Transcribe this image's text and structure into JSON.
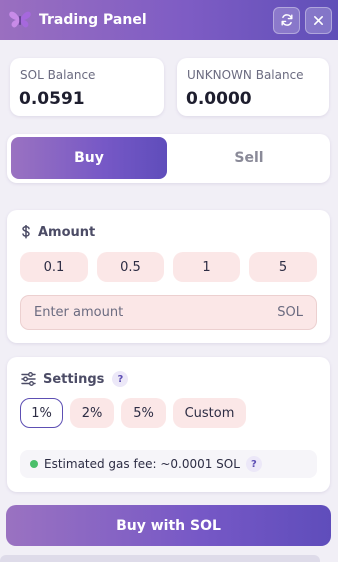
{
  "header": {
    "title": "Trading Panel"
  },
  "balances": [
    {
      "label": "SOL Balance",
      "value": "0.0591"
    },
    {
      "label": "UNKNOWN Balance",
      "value": "0.0000"
    }
  ],
  "tabs": {
    "buy": "Buy",
    "sell": "Sell"
  },
  "amount": {
    "title": "Amount",
    "presets": [
      "0.1",
      "0.5",
      "1",
      "5"
    ],
    "placeholder": "Enter amount",
    "unit": "SOL"
  },
  "settings": {
    "title": "Settings",
    "help": "?",
    "slippage": [
      "1%",
      "2%",
      "5%",
      "Custom"
    ],
    "selected": "1%",
    "gas_fee": "Estimated gas fee: ~0.0001 SOL",
    "gas_help": "?"
  },
  "action": {
    "label": "Buy with SOL"
  },
  "colors": {
    "accent": "#7658c6",
    "chip": "#fbe7e7",
    "gas_indicator": "#4bbf6b"
  }
}
